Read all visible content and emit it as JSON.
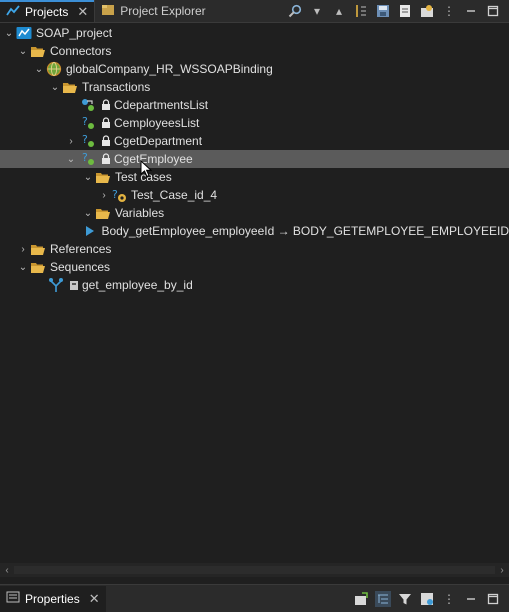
{
  "tabs": [
    {
      "label": "Projects",
      "active": true
    },
    {
      "label": "Project Explorer",
      "active": false
    }
  ],
  "tree": [
    {
      "label": "SOAP_project",
      "icon": "project-icon",
      "expanded": true,
      "selected": false
    },
    {
      "label": "Connectors",
      "icon": "folder-open-icon",
      "expanded": true,
      "selected": false
    },
    {
      "label": "globalCompany_HR_WSSOAPBinding",
      "icon": "globe-connector-icon",
      "expanded": true,
      "selected": false
    },
    {
      "label": "Transactions",
      "icon": "folder-open-icon",
      "expanded": true,
      "selected": false
    },
    {
      "label": "CdepartmentsList",
      "icon": "transaction-icon",
      "selected": false
    },
    {
      "label": "CemployeesList",
      "icon": "transaction-icon",
      "selected": false
    },
    {
      "label": "CgetDepartment",
      "icon": "transaction-icon",
      "expanded": false,
      "selected": false
    },
    {
      "label": "CgetEmployee",
      "icon": "transaction-icon",
      "expanded": true,
      "selected": true
    },
    {
      "label": "Test cases",
      "icon": "folder-open-icon",
      "expanded": true,
      "selected": false
    },
    {
      "label": "Test_Case_id_4",
      "icon": "test-case-icon",
      "expanded": false,
      "selected": false
    },
    {
      "label": "Variables",
      "icon": "folder-open-icon",
      "expanded": true,
      "selected": false
    },
    {
      "label": "Body_getEmployee_employeeId → BODY_GETEMPLOYEE_EMPLOYEEID",
      "icon": "variable-icon",
      "selected": false
    },
    {
      "label": "References",
      "icon": "folder-open-icon",
      "expanded": false,
      "selected": false
    },
    {
      "label": "Sequences",
      "icon": "folder-open-icon",
      "expanded": true,
      "selected": false
    },
    {
      "label": "get_employee_by_id",
      "icon": "sequence-icon",
      "selected": false
    }
  ],
  "bottom_tabs": [
    {
      "label": "Properties",
      "active": true
    }
  ],
  "colors": {
    "background": "#1f1f1f",
    "selection": "#5b5b5b",
    "accent": "#3c8fd6",
    "folder": "#e3b341"
  }
}
